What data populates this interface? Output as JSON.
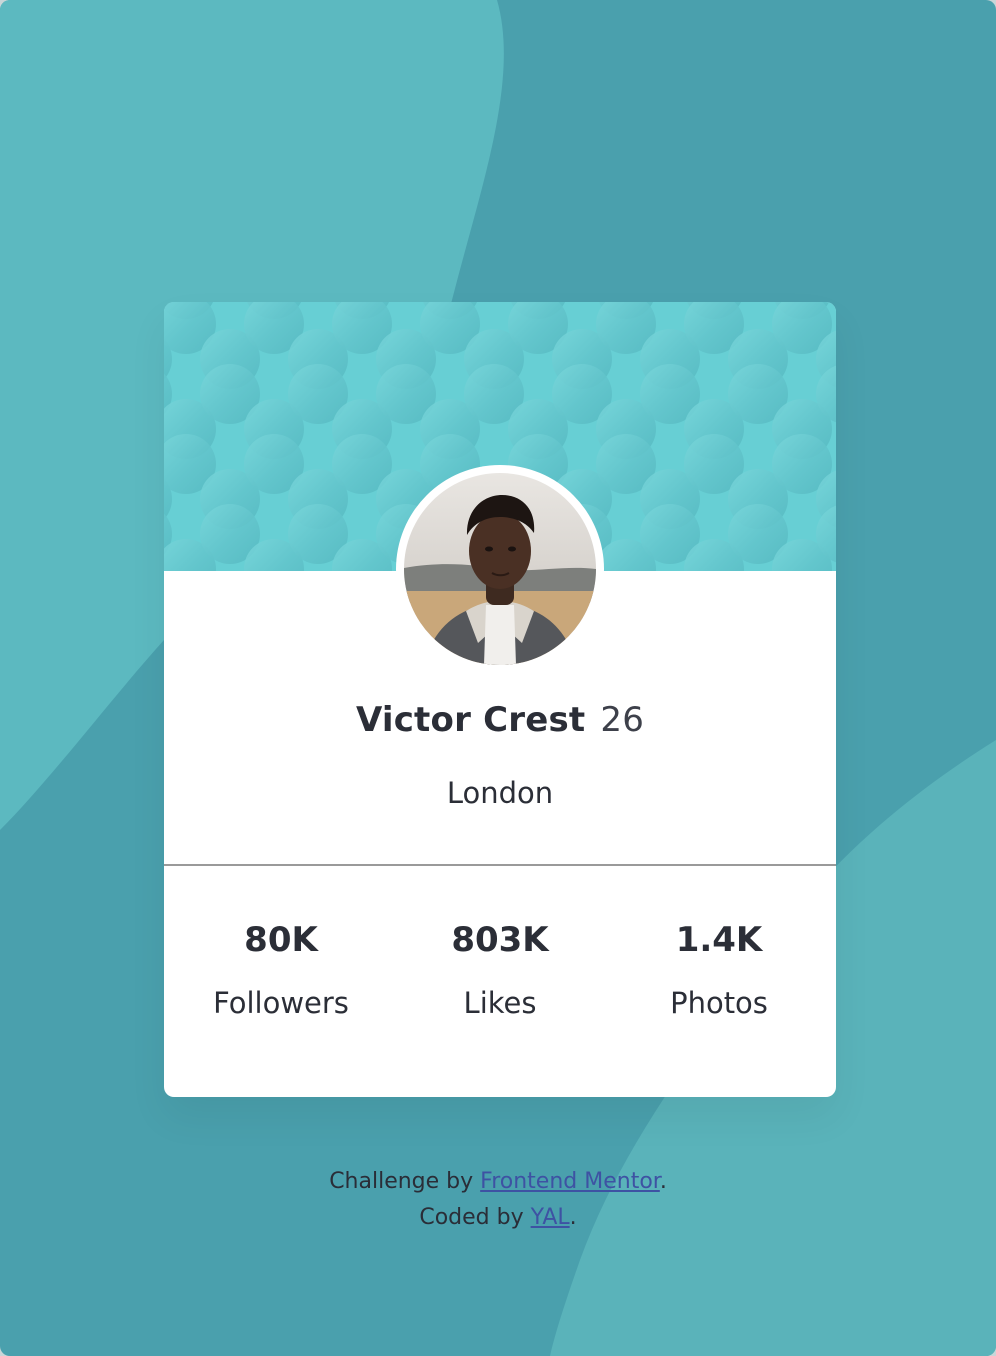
{
  "profile": {
    "name": "Victor Crest",
    "age": "26",
    "location": "London"
  },
  "stats": [
    {
      "value": "80K",
      "label": "Followers"
    },
    {
      "value": "803K",
      "label": "Likes"
    },
    {
      "value": "1.4K",
      "label": "Photos"
    }
  ],
  "attribution": {
    "challenge_prefix": "Challenge by ",
    "challenge_link": "Frontend Mentor",
    "challenge_suffix": ".",
    "coded_prefix": "Coded by ",
    "coded_link": "YAL",
    "coded_suffix": "."
  },
  "colors": {
    "page_bg": "#4aa0ad",
    "header_bg": "#64cbd0",
    "card_bg": "#ffffff",
    "text_dark": "#2b2e37",
    "link": "#3e52a3"
  }
}
